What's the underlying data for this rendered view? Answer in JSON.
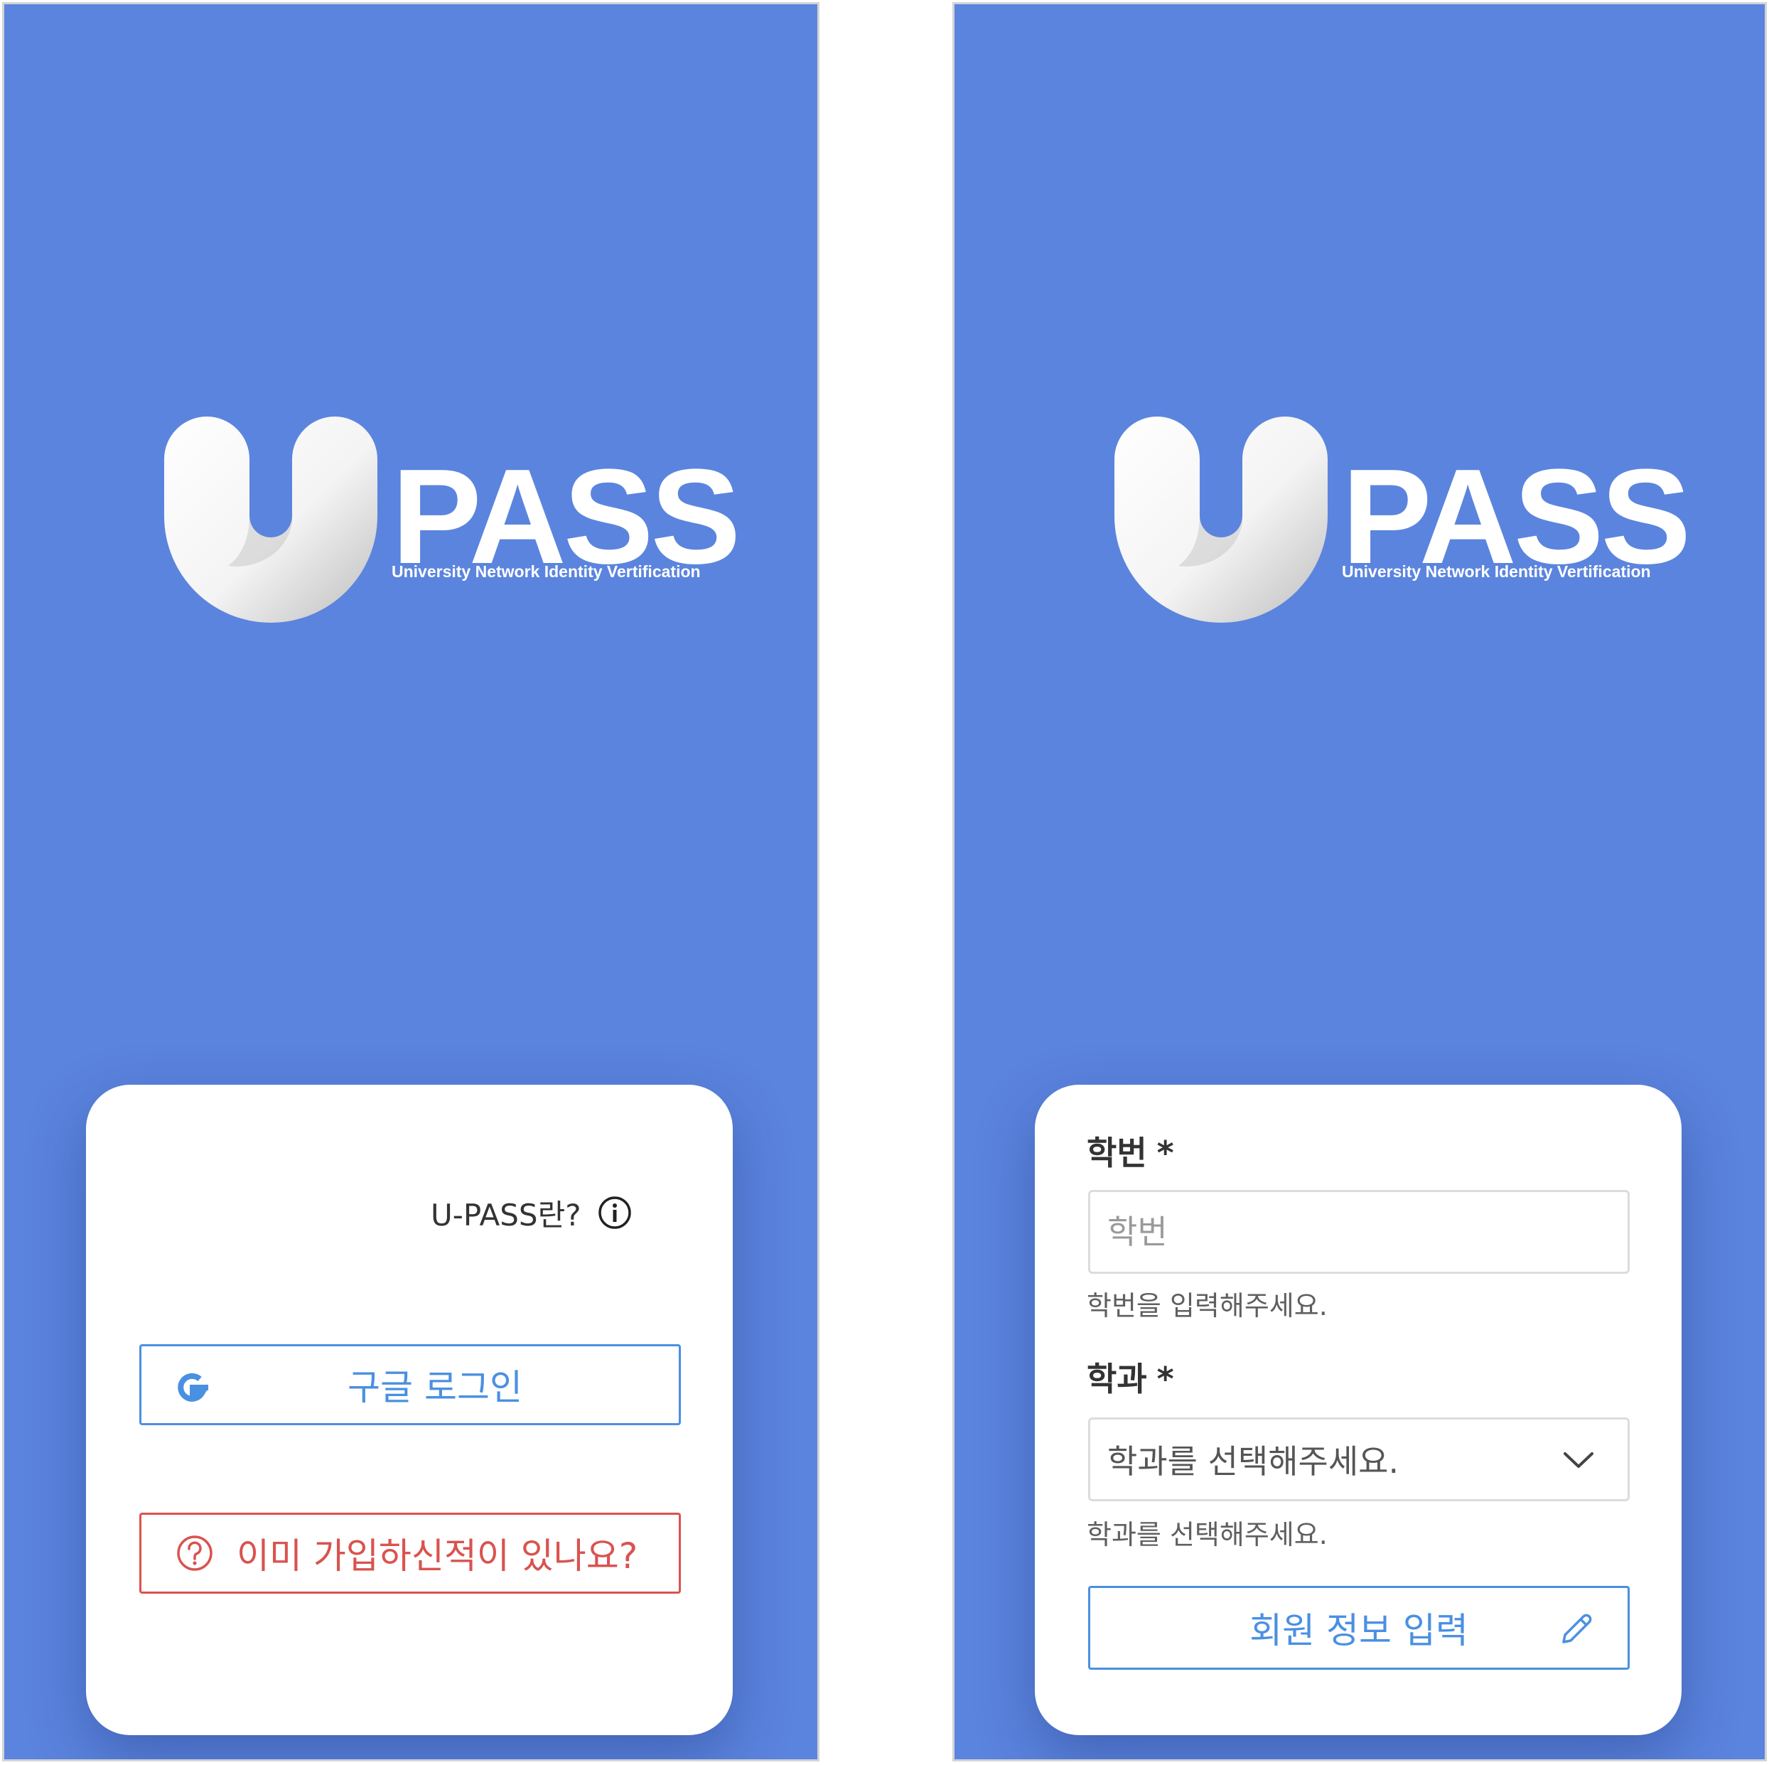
{
  "logo": {
    "wordmark": "PASS",
    "tagline": "University Network Identity Vertification"
  },
  "colors": {
    "background": "#5b84de",
    "primary": "#4a90e2",
    "danger": "#d9534f"
  },
  "login_screen": {
    "about_link": "U-PASS란?",
    "about_icon": "info-icon",
    "google_button": {
      "label": "구글 로그인",
      "icon": "google-icon"
    },
    "already_button": {
      "label": "이미 가입하신적이 있나요?",
      "icon": "question-circle-icon"
    }
  },
  "signup_screen": {
    "student_id": {
      "label": "학번",
      "required_mark": "*",
      "placeholder": "학번",
      "helper": "학번을 입력해주세요."
    },
    "department": {
      "label": "학과",
      "required_mark": "*",
      "selected": "학과를 선택해주세요.",
      "helper": "학과를 선택해주세요."
    },
    "submit_button": {
      "label": "회원 정보 입력",
      "icon": "pencil-icon"
    }
  }
}
